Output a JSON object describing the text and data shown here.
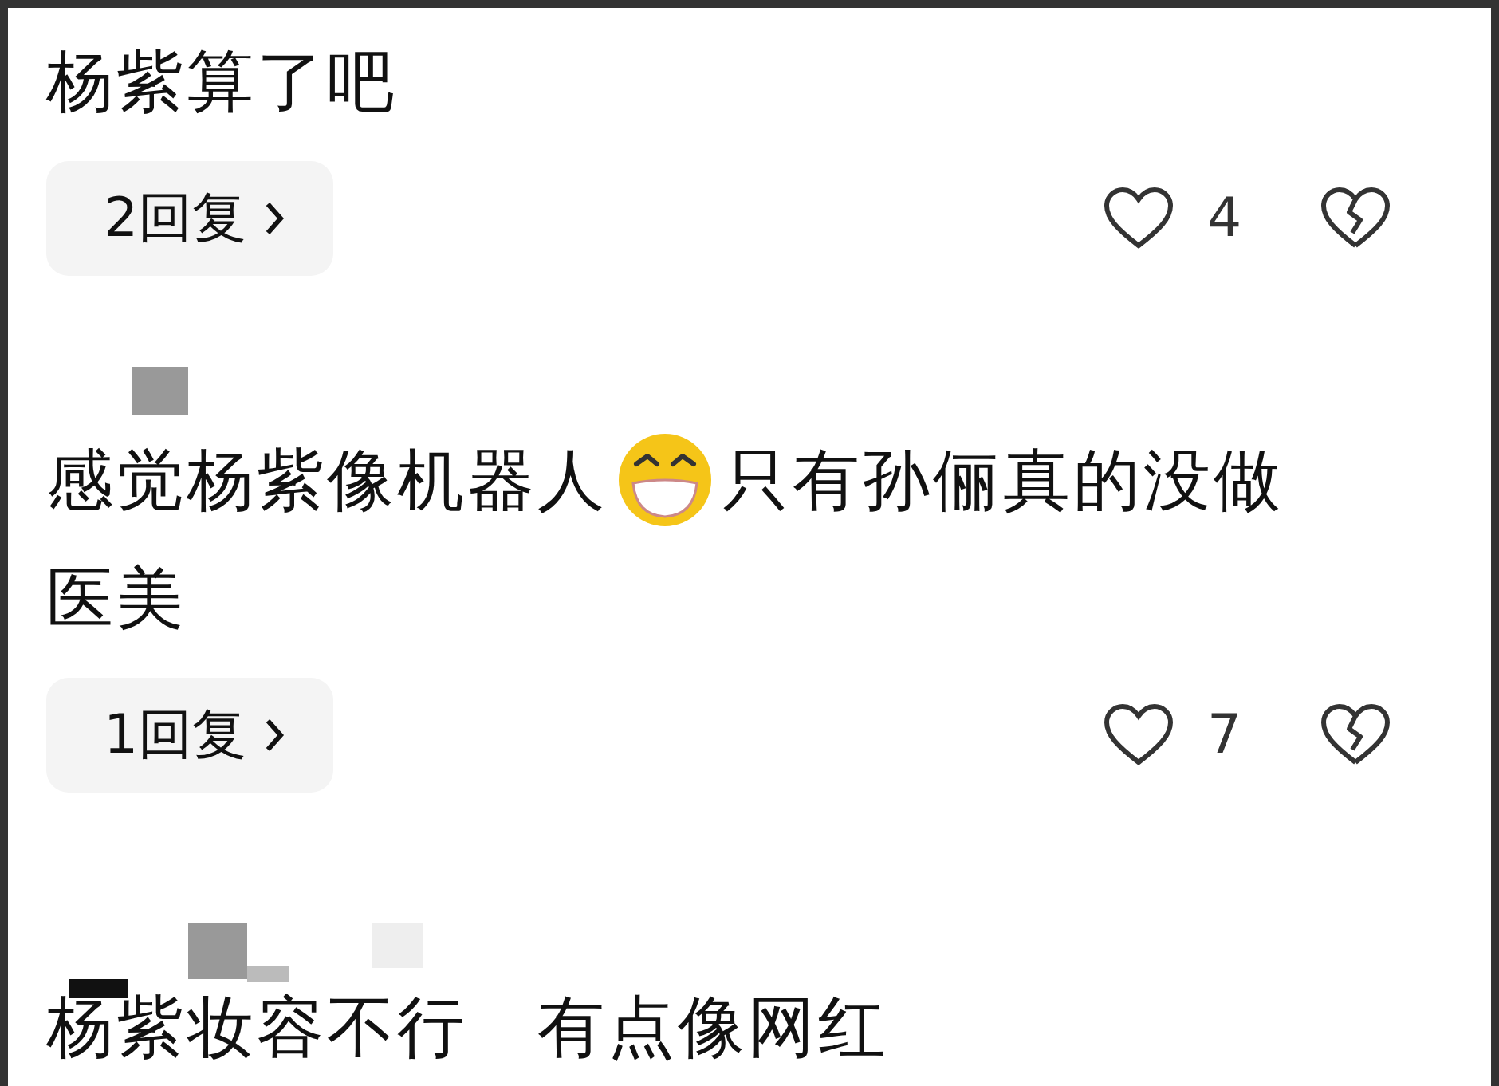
{
  "comments": [
    {
      "kind": "plain",
      "lines": [
        [
          {
            "kind": "text",
            "text": "杨紫算了吧"
          }
        ]
      ],
      "replies": "2回复",
      "likes": "4"
    },
    {
      "kind": "single",
      "lines": [
        [
          {
            "kind": "text",
            "text": "感觉杨紫像机器人"
          },
          {
            "kind": "emoji"
          },
          {
            "kind": "text",
            "text": "只有孙俪真的没做"
          }
        ],
        [
          {
            "kind": "text",
            "text": "医美"
          }
        ]
      ],
      "replies": "1回复",
      "likes": "7"
    },
    {
      "kind": "cluster",
      "lines": [
        [
          {
            "kind": "text",
            "text": "杨紫妆容不行　有点像网红"
          }
        ]
      ]
    }
  ]
}
